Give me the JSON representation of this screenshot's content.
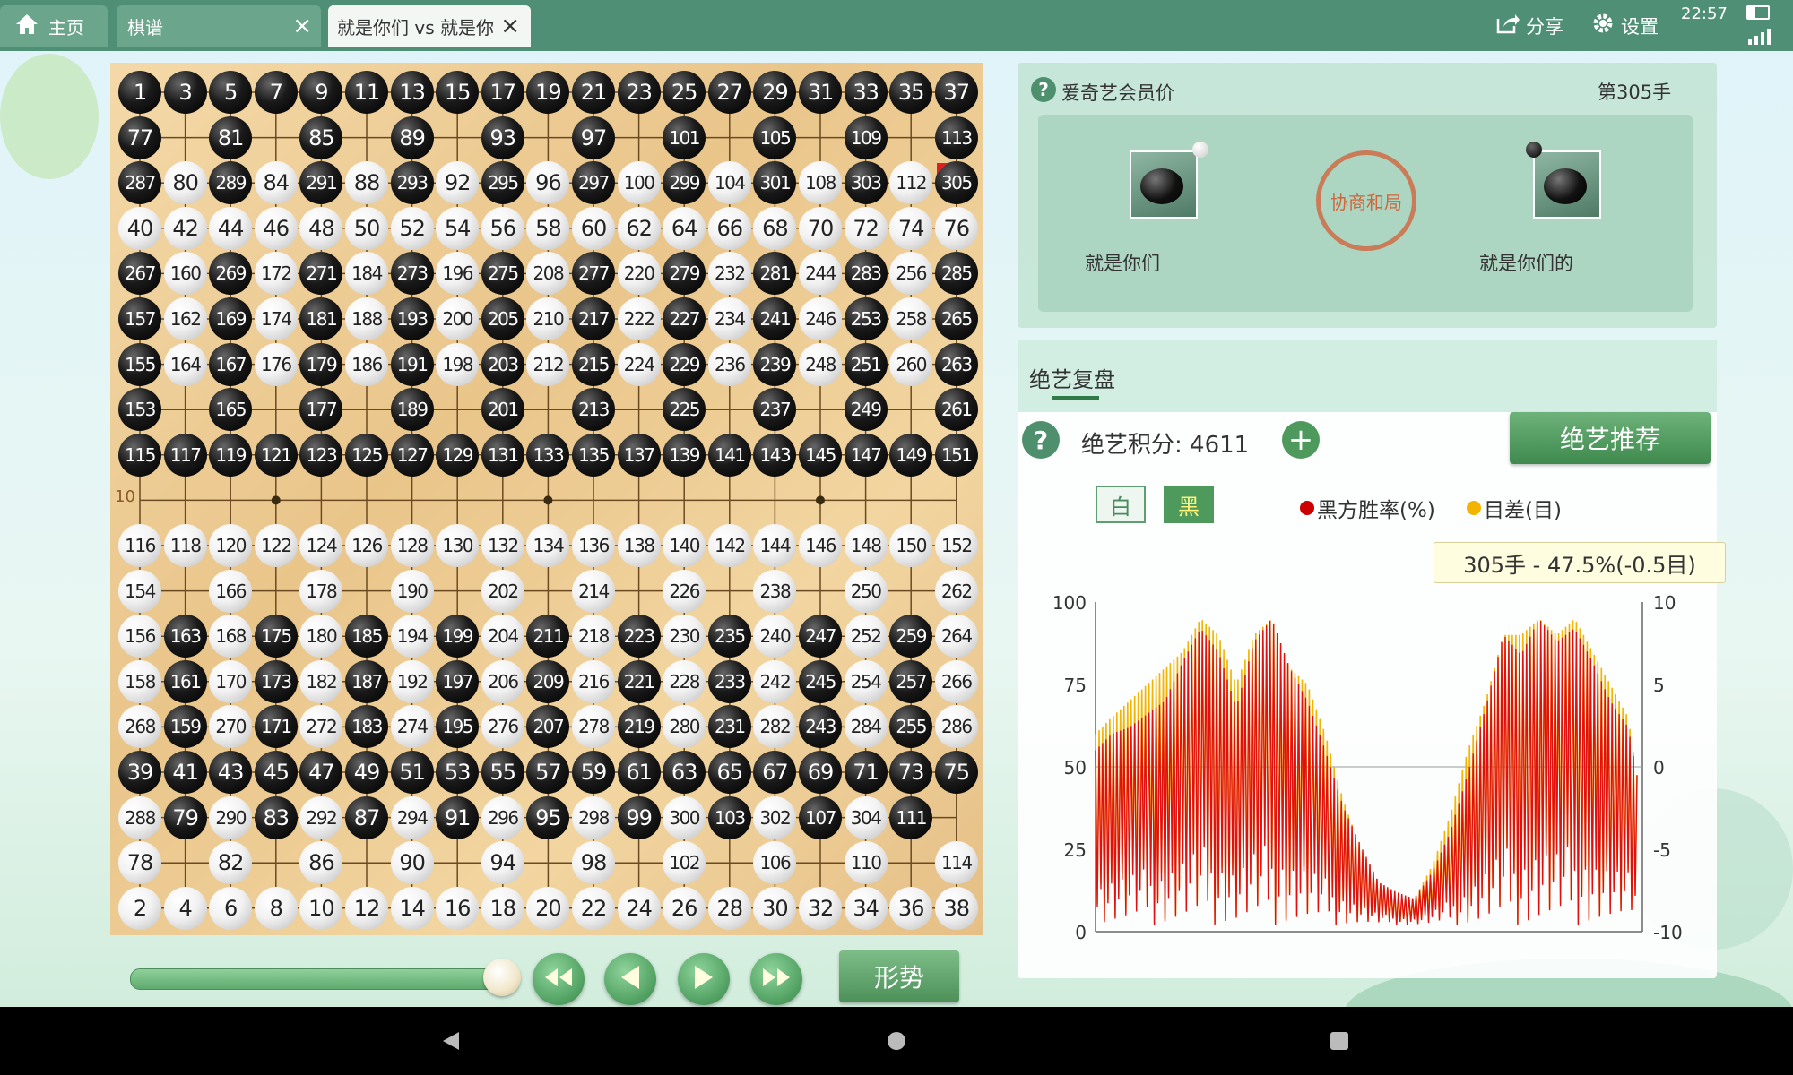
{
  "tabs": {
    "home": "主页",
    "qipu": "棋谱",
    "active": "就是你们 vs 就是你"
  },
  "topbar": {
    "share": "分享",
    "settings": "设置",
    "time": "22:57"
  },
  "board": {
    "row_label": "10",
    "rows": [
      [
        "1",
        "3",
        "5",
        "7",
        "9",
        "11",
        "13",
        "15",
        "17",
        "19",
        "21",
        "23",
        "25",
        "27",
        "29",
        "31",
        "33",
        "35",
        "37"
      ],
      [
        "77",
        "",
        "81",
        "",
        "85",
        "",
        "89",
        "",
        "93",
        "",
        "97",
        "",
        "101",
        "",
        "105",
        "",
        "109",
        "",
        "113"
      ],
      [
        "287",
        "80",
        "289",
        "84",
        "291",
        "88",
        "293",
        "92",
        "295",
        "96",
        "297",
        "100",
        "299",
        "104",
        "301",
        "108",
        "303",
        "112",
        "305"
      ],
      [
        "40",
        "42",
        "44",
        "46",
        "48",
        "50",
        "52",
        "54",
        "56",
        "58",
        "60",
        "62",
        "64",
        "66",
        "68",
        "70",
        "72",
        "74",
        "76"
      ],
      [
        "267",
        "160",
        "269",
        "172",
        "271",
        "184",
        "273",
        "196",
        "275",
        "208",
        "277",
        "220",
        "279",
        "232",
        "281",
        "244",
        "283",
        "256",
        "285"
      ],
      [
        "157",
        "162",
        "169",
        "174",
        "181",
        "188",
        "193",
        "200",
        "205",
        "210",
        "217",
        "222",
        "227",
        "234",
        "241",
        "246",
        "253",
        "258",
        "265"
      ],
      [
        "155",
        "164",
        "167",
        "176",
        "179",
        "186",
        "191",
        "198",
        "203",
        "212",
        "215",
        "224",
        "229",
        "236",
        "239",
        "248",
        "251",
        "260",
        "263"
      ],
      [
        "153",
        "",
        "165",
        "",
        "177",
        "",
        "189",
        "",
        "201",
        "",
        "213",
        "",
        "225",
        "",
        "237",
        "",
        "249",
        "",
        "261"
      ],
      [
        "115",
        "117",
        "119",
        "121",
        "123",
        "125",
        "127",
        "129",
        "131",
        "133",
        "135",
        "137",
        "139",
        "141",
        "143",
        "145",
        "147",
        "149",
        "151"
      ],
      [
        "",
        "",
        "",
        "",
        "",
        "",
        "",
        "",
        "",
        "",
        "",
        "",
        "",
        "",
        "",
        "",
        "",
        "",
        ""
      ],
      [
        "116",
        "118",
        "120",
        "122",
        "124",
        "126",
        "128",
        "130",
        "132",
        "134",
        "136",
        "138",
        "140",
        "142",
        "144",
        "146",
        "148",
        "150",
        "152"
      ],
      [
        "154",
        "",
        "166",
        "",
        "178",
        "",
        "190",
        "",
        "202",
        "",
        "214",
        "",
        "226",
        "",
        "238",
        "",
        "250",
        "",
        "262"
      ],
      [
        "156",
        "163",
        "168",
        "175",
        "180",
        "185",
        "194",
        "199",
        "204",
        "211",
        "218",
        "223",
        "230",
        "235",
        "240",
        "247",
        "252",
        "259",
        "264"
      ],
      [
        "158",
        "161",
        "170",
        "173",
        "182",
        "187",
        "192",
        "197",
        "206",
        "209",
        "216",
        "221",
        "228",
        "233",
        "242",
        "245",
        "254",
        "257",
        "266"
      ],
      [
        "268",
        "159",
        "270",
        "171",
        "272",
        "183",
        "274",
        "195",
        "276",
        "207",
        "278",
        "219",
        "280",
        "231",
        "282",
        "243",
        "284",
        "255",
        "286"
      ],
      [
        "39",
        "41",
        "43",
        "45",
        "47",
        "49",
        "51",
        "53",
        "55",
        "57",
        "59",
        "61",
        "63",
        "65",
        "67",
        "69",
        "71",
        "73",
        "75"
      ],
      [
        "288",
        "79",
        "290",
        "83",
        "292",
        "87",
        "294",
        "91",
        "296",
        "95",
        "298",
        "99",
        "300",
        "103",
        "302",
        "107",
        "304",
        "111",
        ""
      ],
      [
        "78",
        "",
        "82",
        "",
        "86",
        "",
        "90",
        "",
        "94",
        "",
        "98",
        "",
        "102",
        "",
        "106",
        "",
        "110",
        "",
        "114"
      ],
      [
        "2",
        "4",
        "6",
        "8",
        "10",
        "12",
        "14",
        "16",
        "18",
        "20",
        "22",
        "24",
        "26",
        "28",
        "30",
        "32",
        "34",
        "36",
        "38"
      ]
    ],
    "last_move": "305"
  },
  "controls": {
    "slider_progress": 1.0,
    "situation_button": "形势"
  },
  "player_panel": {
    "membership": "爱奇艺会员价",
    "move_no": "第305手",
    "white_player": "就是你们",
    "black_player": "就是你们的",
    "result_seal": "协商和局"
  },
  "analysis": {
    "tab": "绝艺复盘",
    "score_label": "绝艺积分: 4611",
    "recommend_button": "绝艺推荐",
    "toggle_white": "白",
    "toggle_black": "黑",
    "legend_winrate": "黑方胜率(%)",
    "legend_diff": "目差(目)",
    "tooltip": "305手 - 47.5%(-0.5目)"
  },
  "chart_data": {
    "type": "line",
    "y_left_ticks": [
      "100",
      "75",
      "50",
      "25",
      "0"
    ],
    "y_right_ticks": [
      "10",
      "5",
      "0",
      "-5",
      "-10"
    ],
    "ylim_left": [
      0,
      100
    ],
    "ylim_right": [
      -10,
      10
    ],
    "x_range": [
      1,
      305
    ],
    "colors": {
      "winrate": "#e01010",
      "diff": "#f3b400"
    },
    "series": [
      {
        "name": "黑方胜率(%)",
        "key": "winrate",
        "envelope": [
          [
            1,
            55
          ],
          [
            10,
            60
          ],
          [
            20,
            62
          ],
          [
            30,
            66
          ],
          [
            40,
            70
          ],
          [
            50,
            82
          ],
          [
            60,
            92
          ],
          [
            70,
            85
          ],
          [
            80,
            68
          ],
          [
            90,
            88
          ],
          [
            100,
            95
          ],
          [
            110,
            80
          ],
          [
            120,
            70
          ],
          [
            130,
            55
          ],
          [
            140,
            38
          ],
          [
            150,
            26
          ],
          [
            160,
            15
          ],
          [
            170,
            12
          ],
          [
            180,
            10
          ],
          [
            190,
            18
          ],
          [
            200,
            30
          ],
          [
            210,
            48
          ],
          [
            220,
            68
          ],
          [
            230,
            90
          ],
          [
            240,
            84
          ],
          [
            250,
            95
          ],
          [
            260,
            88
          ],
          [
            270,
            92
          ],
          [
            280,
            82
          ],
          [
            290,
            70
          ],
          [
            300,
            62
          ],
          [
            305,
            47.5
          ]
        ]
      },
      {
        "name": "目差(目)",
        "key": "diff",
        "envelope": [
          [
            1,
            2
          ],
          [
            10,
            3
          ],
          [
            20,
            4
          ],
          [
            30,
            5
          ],
          [
            40,
            6
          ],
          [
            50,
            7
          ],
          [
            60,
            9
          ],
          [
            70,
            8
          ],
          [
            80,
            5
          ],
          [
            90,
            8
          ],
          [
            100,
            9
          ],
          [
            110,
            6
          ],
          [
            120,
            5
          ],
          [
            130,
            2
          ],
          [
            140,
            -2
          ],
          [
            150,
            -5
          ],
          [
            160,
            -7
          ],
          [
            170,
            -8
          ],
          [
            180,
            -8
          ],
          [
            190,
            -6
          ],
          [
            200,
            -3
          ],
          [
            210,
            1
          ],
          [
            220,
            4
          ],
          [
            230,
            8
          ],
          [
            240,
            8
          ],
          [
            250,
            9
          ],
          [
            260,
            8
          ],
          [
            270,
            9
          ],
          [
            280,
            7
          ],
          [
            290,
            5
          ],
          [
            300,
            3
          ],
          [
            305,
            -0.5
          ]
        ]
      }
    ]
  }
}
